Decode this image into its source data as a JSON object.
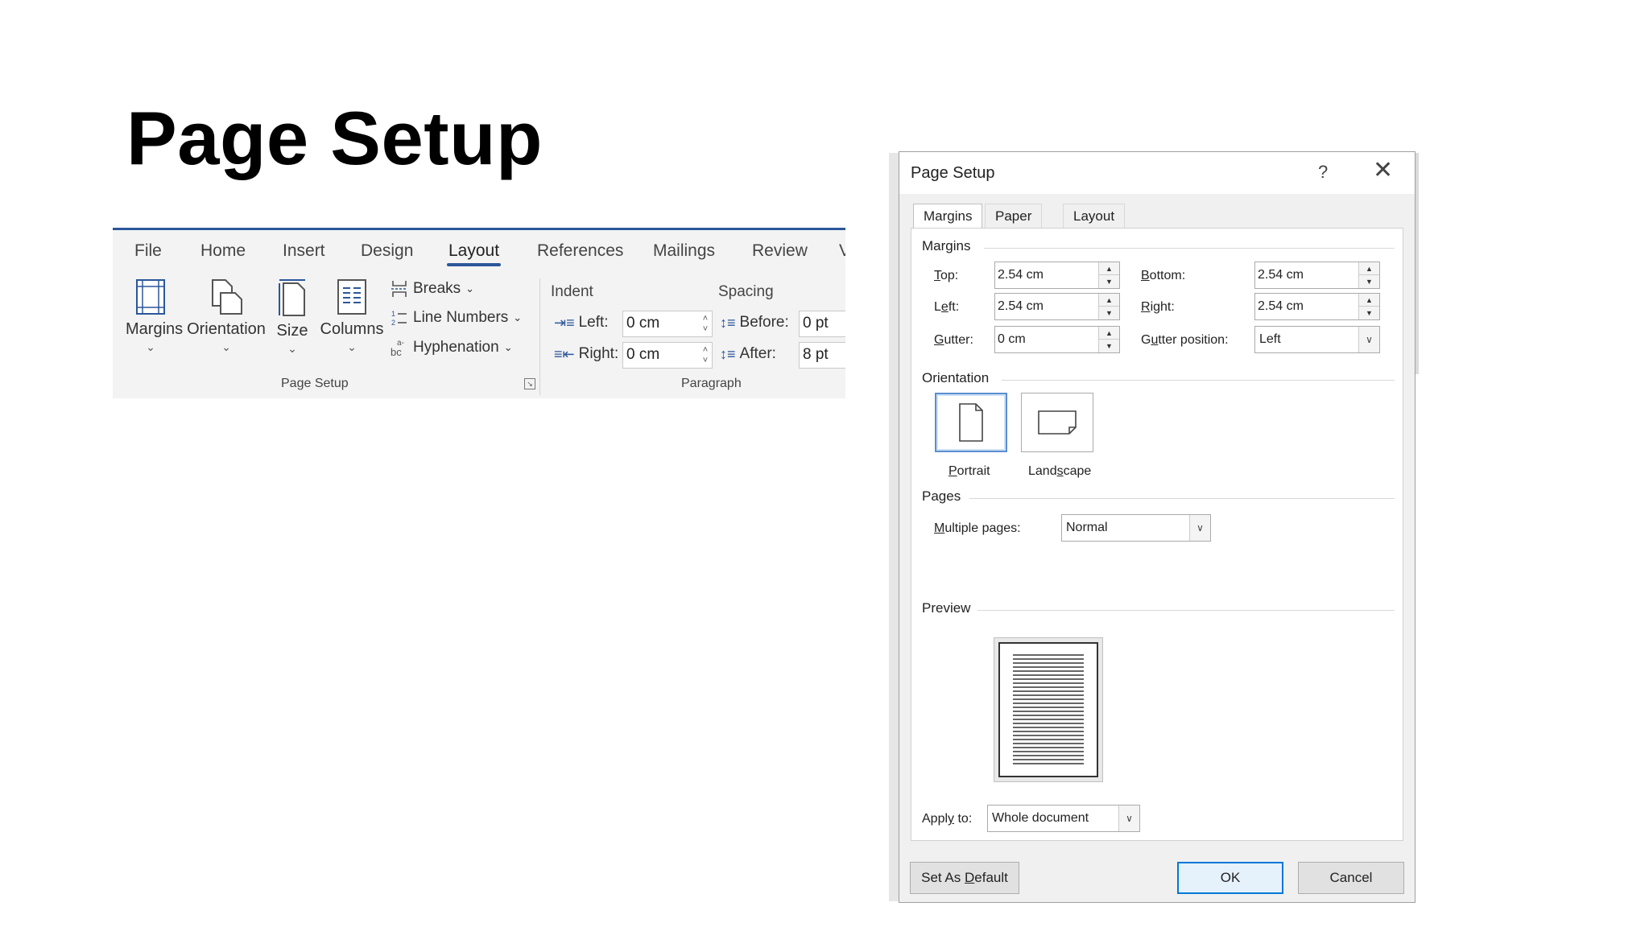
{
  "slide": {
    "title": "Page Setup"
  },
  "ribbon": {
    "tabs": [
      "File",
      "Home",
      "Insert",
      "Design",
      "Layout",
      "References",
      "Mailings",
      "Review",
      "V"
    ],
    "active_tab": "Layout",
    "page_setup": {
      "margins": "Margins",
      "orientation": "Orientation",
      "size": "Size",
      "columns": "Columns",
      "breaks": "Breaks",
      "line_numbers": "Line Numbers",
      "hyphenation": "Hyphenation",
      "group_label": "Page Setup"
    },
    "paragraph": {
      "indent_head": "Indent",
      "spacing_head": "Spacing",
      "left_label": "Left:",
      "left_value": "0 cm",
      "right_label": "Right:",
      "right_value": "0 cm",
      "before_label": "Before:",
      "before_value": "0 pt",
      "after_label": "After:",
      "after_value": "8 pt",
      "group_label": "Paragraph"
    }
  },
  "dialog": {
    "title": "Page Setup",
    "help": "?",
    "close": "✕",
    "tabs": [
      "Margins",
      "Paper",
      "Layout"
    ],
    "active_tab": "Margins",
    "margins_section": "Margins",
    "top": {
      "label_u": "T",
      "label_rest": "op:",
      "value": "2.54 cm"
    },
    "bottom": {
      "label_u": "B",
      "label_rest": "ottom:",
      "value": "2.54 cm"
    },
    "left": {
      "label_pre": "L",
      "label_u": "e",
      "label_rest": "ft:",
      "value": "2.54 cm"
    },
    "right": {
      "label_u": "R",
      "label_rest": "ight:",
      "value": "2.54 cm"
    },
    "gutter": {
      "label_u": "G",
      "label_rest": "utter:",
      "value": "0 cm"
    },
    "gutter_position": {
      "label_pre": "G",
      "label_u": "u",
      "label_rest": "tter position:",
      "value": "Left"
    },
    "orientation_section": "Orientation",
    "portrait": {
      "label_u": "P",
      "label_rest": "ortrait"
    },
    "landscape": {
      "label_pre": "Land",
      "label_u": "s",
      "label_rest": "cape"
    },
    "pages_section": "Pages",
    "multiple_pages": {
      "label_u": "M",
      "label_rest": "ultiple pages:",
      "value": "Normal"
    },
    "preview_section": "Preview",
    "apply_to": {
      "label_pre": "Appl",
      "label_u": "y",
      "label_rest": " to:",
      "value": "Whole document"
    },
    "buttons": {
      "set_default_pre": "Set As ",
      "set_default_u": "D",
      "set_default_rest": "efault",
      "ok": "OK",
      "cancel": "Cancel"
    }
  }
}
